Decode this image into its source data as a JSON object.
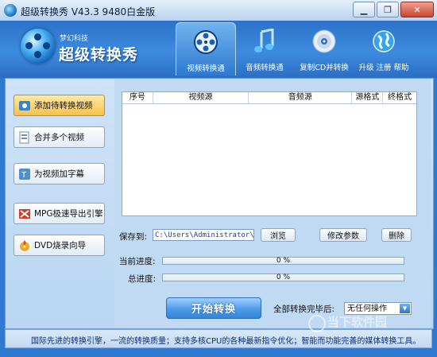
{
  "window": {
    "title": "超级转换秀 V43.3 9480白金版",
    "minimize_icon": "minimize-icon",
    "restore_icon": "restore-icon",
    "close_icon": "close-icon"
  },
  "brand": {
    "sub": "梦幻科技",
    "name": "超级转换秀"
  },
  "nav": {
    "tabs": [
      {
        "label": "视频转换通",
        "icon": "film-reel-icon",
        "active": true
      },
      {
        "label": "音频转换通",
        "icon": "music-note-icon",
        "active": false
      },
      {
        "label": "复制CD并转换",
        "icon": "cd-disc-icon",
        "active": false
      },
      {
        "label": "升级 注册 帮助",
        "icon": "globe-icon",
        "active": false
      }
    ]
  },
  "sidebar": {
    "items": [
      {
        "label": "添加待转换视频",
        "icon": "add-video-icon",
        "active": true
      },
      {
        "label": "合并多个视频",
        "icon": "merge-video-icon",
        "active": false
      },
      {
        "label": "为视频加字幕",
        "icon": "subtitle-icon",
        "active": false
      },
      {
        "label": "MPG极速导出引擎",
        "icon": "mpg-engine-icon",
        "active": false
      },
      {
        "label": "DVD烧录向导",
        "icon": "dvd-burn-icon",
        "active": false
      }
    ]
  },
  "file_list": {
    "columns": [
      "序号",
      "视频源",
      "音频源",
      "源格式",
      "终格式"
    ]
  },
  "save": {
    "label": "保存到:",
    "path": "C:\\Users\\Administrator\\Desktop",
    "browse": "浏览",
    "modify": "修改参数",
    "delete": "删除"
  },
  "progress": {
    "current_label": "当前进度:",
    "current_value": 0,
    "current_text": "0 %",
    "total_label": "总进度:",
    "total_value": 0,
    "total_text": "0 %"
  },
  "actions": {
    "start": "开始转换",
    "after_label": "全部转换完毕后:",
    "after_value": "无任何操作"
  },
  "status": {
    "message": "国际先进的转换引擎，一流的转换质量；支持多核CPU的各种最新指令优化；智能而功能完善的媒体转换工具。"
  },
  "watermark": "当下软件园",
  "colors": {
    "accent": "#2f7ad0",
    "active_item": "#f8c24a",
    "status_text": "#0b2f7a"
  }
}
